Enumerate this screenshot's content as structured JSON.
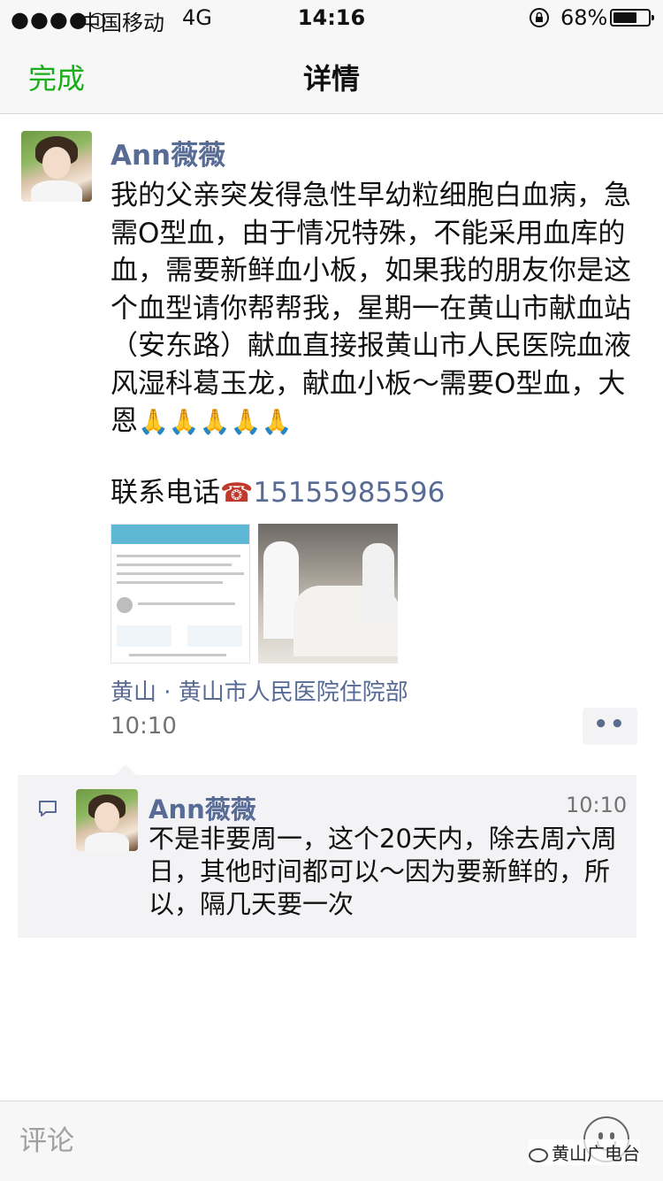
{
  "status_bar": {
    "signal": "●●●●○",
    "carrier": "中国移动",
    "network": "4G",
    "time": "14:16",
    "battery_text": "68%",
    "battery_level": 0.68
  },
  "nav": {
    "done_label": "完成",
    "title": "详情"
  },
  "post": {
    "author": "Ann薇薇",
    "text": "我的父亲突发得急性早幼粒细胞白血病，急需O型血，由于情况特殊，不能采用血库的血，需要新鲜血小板，如果我的朋友你是这个血型请你帮帮我，星期一在黄山市献血站（安东路）献血直接报黄山市人民医院血液风湿科葛玉龙，献血小板～需要O型血，大恩",
    "emoji": "🙏🙏🙏🙏🙏",
    "contact_label": "联系电话",
    "phone_icon": "☎",
    "phone": "15155985596",
    "location": "黄山 · 黄山市人民医院住院部",
    "time": "10:10",
    "more_label": "••"
  },
  "comment": {
    "author": "Ann薇薇",
    "time": "10:10",
    "text": "不是非要周一，这个20天内，除去周六周日，其他时间都可以～因为要新鲜的，所以，隔几天要一次"
  },
  "input": {
    "placeholder": "评论"
  },
  "watermark": "黄山广电台",
  "colors": {
    "link": "#576b95",
    "accent_green": "#1aad19"
  }
}
